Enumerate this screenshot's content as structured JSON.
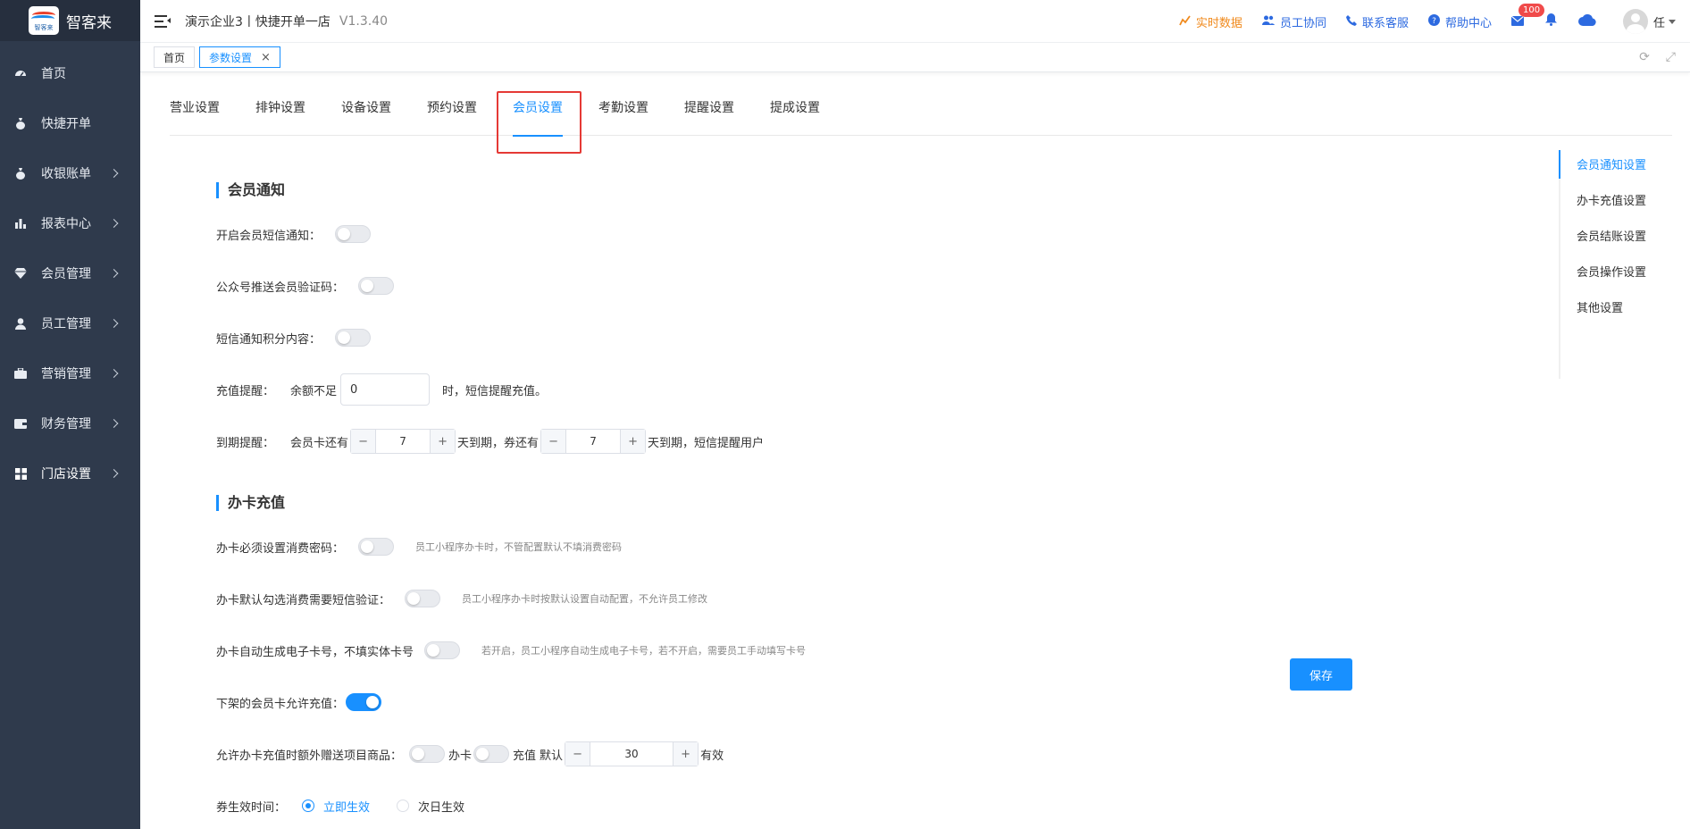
{
  "brand": {
    "name": "智客来",
    "logo_text": "智客来"
  },
  "sidebar": {
    "items": [
      {
        "label": "首页",
        "icon": "dashboard-icon",
        "has_children": false
      },
      {
        "label": "快捷开单",
        "icon": "money-bag-icon",
        "has_children": false
      },
      {
        "label": "收银账单",
        "icon": "money-bag-icon",
        "has_children": true
      },
      {
        "label": "报表中心",
        "icon": "bar-chart-icon",
        "has_children": true
      },
      {
        "label": "会员管理",
        "icon": "diamond-icon",
        "has_children": true
      },
      {
        "label": "员工管理",
        "icon": "user-icon",
        "has_children": true
      },
      {
        "label": "营销管理",
        "icon": "briefcase-icon",
        "has_children": true
      },
      {
        "label": "财务管理",
        "icon": "wallet-icon",
        "has_children": true
      },
      {
        "label": "门店设置",
        "icon": "grid-icon",
        "has_children": true,
        "active": true
      }
    ]
  },
  "header": {
    "company": "演示企业3丨快捷开单一店",
    "version": "V1.3.40",
    "links": [
      {
        "label": "实时数据",
        "icon": "chart-line-icon",
        "color": "#f08a1d"
      },
      {
        "label": "员工协同",
        "icon": "users-icon",
        "color": "#2d6ae0"
      },
      {
        "label": "联系客服",
        "icon": "phone-icon",
        "color": "#2d6ae0"
      },
      {
        "label": "帮助中心",
        "icon": "help-icon",
        "color": "#2d6ae0"
      }
    ],
    "mail_badge": "100",
    "user_name": "任"
  },
  "page_tabs": [
    {
      "label": "首页",
      "active": false
    },
    {
      "label": "参数设置",
      "active": true
    }
  ],
  "subtabs": [
    "营业设置",
    "排钟设置",
    "设备设置",
    "预约设置",
    "会员设置",
    "考勤设置",
    "提醒设置",
    "提成设置"
  ],
  "active_subtab": "会员设置",
  "anchors": [
    "会员通知设置",
    "办卡充值设置",
    "会员结账设置",
    "会员操作设置",
    "其他设置"
  ],
  "section1": {
    "title": "会员通知",
    "sms_notify": {
      "label": "开启会员短信通知：",
      "on": false
    },
    "wechat_code": {
      "label": "公众号推送会员验证码：",
      "on": false
    },
    "sms_points": {
      "label": "短信通知积分内容：",
      "on": false
    },
    "recharge": {
      "label": "充值提醒：",
      "prefix": "余额不足",
      "value": "0",
      "suffix": "时，短信提醒充值。"
    },
    "expire": {
      "label": "到期提醒：",
      "card_prefix": "会员卡还有",
      "card_days": "7",
      "mid": "天到期，券还有",
      "coupon_days": "7",
      "suffix": "天到期，短信提醒用户",
      "minus": "−",
      "plus": "+"
    }
  },
  "section2": {
    "title": "办卡充值",
    "pwd": {
      "label": "办卡必须设置消费密码：",
      "on": false,
      "hint": "员工小程序办卡时，不管配置默认不填消费密码"
    },
    "sms_verify": {
      "label": "办卡默认勾选消费需要短信验证：",
      "on": false,
      "hint": "员工小程序办卡时按默认设置自动配置，不允许员工修改"
    },
    "auto_card": {
      "label": "办卡自动生成电子卡号，不填实体卡号",
      "on": false,
      "hint": "若开启，员工小程序自动生成电子卡号，若不开启，需要员工手动填写卡号"
    },
    "offline_recharge": {
      "label": "下架的会员卡允许充值：",
      "on": true
    },
    "gift": {
      "label": "允许办卡充值时额外赠送项目商品：",
      "card_label": "办卡",
      "recharge_label": "充值",
      "default_label": "默认",
      "days": "30",
      "suffix": "有效"
    },
    "effect": {
      "label": "券生效时间：",
      "options": [
        "立即生效",
        "次日生效"
      ],
      "selected": "立即生效"
    }
  },
  "save_label": "保存",
  "colors": {
    "accent": "#1890ff",
    "sidebar": "#2f3a4c",
    "highlight": "#e53935"
  }
}
